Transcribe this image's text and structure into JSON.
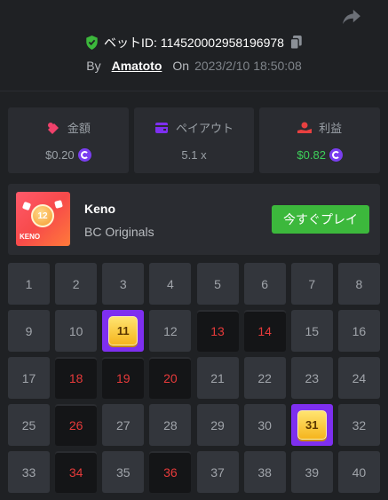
{
  "header": {
    "bet_id_label": "ベットID: 114520002958196978",
    "by_label": "By",
    "author": "Amatoto",
    "on_label": "On",
    "date": "2023/2/10 18:50:08"
  },
  "stats": [
    {
      "label": "金額",
      "value": "$0.20",
      "icon": "bet-chips-icon",
      "coin": true,
      "color": "#f0416b"
    },
    {
      "label": "ペイアウト",
      "value": "5.1 x",
      "icon": "wallet-icon",
      "coin": false,
      "color": "#7e2ff0"
    },
    {
      "label": "利益",
      "value": "$0.82",
      "icon": "profit-hand-icon",
      "coin": true,
      "color": "#e84040"
    }
  ],
  "game": {
    "name": "Keno",
    "provider": "BC Originals",
    "play_label": "今すぐプレイ",
    "thumb_number": "12",
    "thumb_text": "KENO"
  },
  "board": {
    "cells": [
      {
        "n": "1",
        "state": "none"
      },
      {
        "n": "2",
        "state": "none"
      },
      {
        "n": "3",
        "state": "none"
      },
      {
        "n": "4",
        "state": "none"
      },
      {
        "n": "5",
        "state": "none"
      },
      {
        "n": "6",
        "state": "none"
      },
      {
        "n": "7",
        "state": "none"
      },
      {
        "n": "8",
        "state": "none"
      },
      {
        "n": "9",
        "state": "none"
      },
      {
        "n": "10",
        "state": "none"
      },
      {
        "n": "11",
        "state": "hit"
      },
      {
        "n": "12",
        "state": "none"
      },
      {
        "n": "13",
        "state": "miss"
      },
      {
        "n": "14",
        "state": "miss"
      },
      {
        "n": "15",
        "state": "none"
      },
      {
        "n": "16",
        "state": "none"
      },
      {
        "n": "17",
        "state": "none"
      },
      {
        "n": "18",
        "state": "miss"
      },
      {
        "n": "19",
        "state": "miss"
      },
      {
        "n": "20",
        "state": "miss"
      },
      {
        "n": "21",
        "state": "none"
      },
      {
        "n": "22",
        "state": "none"
      },
      {
        "n": "23",
        "state": "none"
      },
      {
        "n": "24",
        "state": "none"
      },
      {
        "n": "25",
        "state": "none"
      },
      {
        "n": "26",
        "state": "miss"
      },
      {
        "n": "27",
        "state": "none"
      },
      {
        "n": "28",
        "state": "none"
      },
      {
        "n": "29",
        "state": "none"
      },
      {
        "n": "30",
        "state": "none"
      },
      {
        "n": "31",
        "state": "hit"
      },
      {
        "n": "32",
        "state": "none"
      },
      {
        "n": "33",
        "state": "none"
      },
      {
        "n": "34",
        "state": "miss"
      },
      {
        "n": "35",
        "state": "none"
      },
      {
        "n": "36",
        "state": "miss"
      },
      {
        "n": "37",
        "state": "none"
      },
      {
        "n": "38",
        "state": "none"
      },
      {
        "n": "39",
        "state": "none"
      },
      {
        "n": "40",
        "state": "none"
      }
    ]
  },
  "colors": {
    "background": "#1f2124",
    "panel": "#2a2c31",
    "hit": "#7e2ff0",
    "miss_text": "#e63a3a",
    "play_button": "#3cb83c",
    "profit": "#3dd05a",
    "shield": "#3cb83c"
  }
}
